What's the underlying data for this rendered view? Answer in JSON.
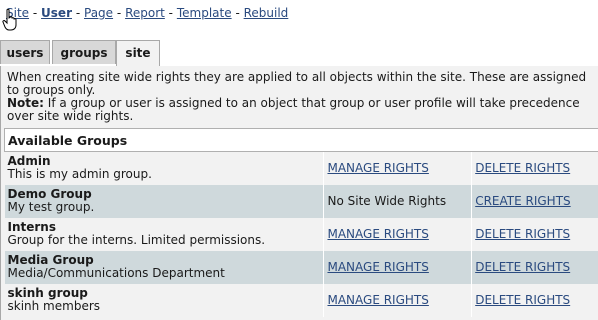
{
  "nav": {
    "links": [
      {
        "label": "Site",
        "current": false
      },
      {
        "label": "User",
        "current": true
      },
      {
        "label": "Page",
        "current": false
      },
      {
        "label": "Report",
        "current": false
      },
      {
        "label": "Template",
        "current": false
      },
      {
        "label": "Rebuild",
        "current": false
      }
    ],
    "separator": "-"
  },
  "tabs": [
    {
      "label": "users",
      "active": false
    },
    {
      "label": "groups",
      "active": false
    },
    {
      "label": "site",
      "active": true
    }
  ],
  "intro": {
    "text": "When creating site wide rights they are applied to all objects within the site. These are assigned to groups only.",
    "note_label": "Note:",
    "note_text": " If a group or user is assigned to an object that group or user profile will take precedence over site wide rights."
  },
  "table": {
    "header": "Available Groups",
    "rows": [
      {
        "name": "Admin",
        "description": "This is my admin group.",
        "col2": "MANAGE RIGHTS",
        "col2_link": true,
        "col3": "DELETE RIGHTS"
      },
      {
        "name": "Demo Group",
        "description": "My test group.",
        "col2": "No Site Wide Rights",
        "col2_link": false,
        "col3": "CREATE RIGHTS"
      },
      {
        "name": "Interns",
        "description": "Group for the interns. Limited permissions.",
        "col2": "MANAGE RIGHTS",
        "col2_link": true,
        "col3": "DELETE RIGHTS"
      },
      {
        "name": "Media Group",
        "description": "Media/Communications Department",
        "col2": "MANAGE RIGHTS",
        "col2_link": true,
        "col3": "DELETE RIGHTS"
      },
      {
        "name": "skinh group",
        "description": "skinh members",
        "col2": "MANAGE RIGHTS",
        "col2_link": true,
        "col3": "DELETE RIGHTS"
      }
    ]
  },
  "colors": {
    "link": "#2a4a7f",
    "row_alt": "#cfd9dc",
    "panel": "#f2f2f2",
    "tab_inactive": "#d8d8d8"
  }
}
